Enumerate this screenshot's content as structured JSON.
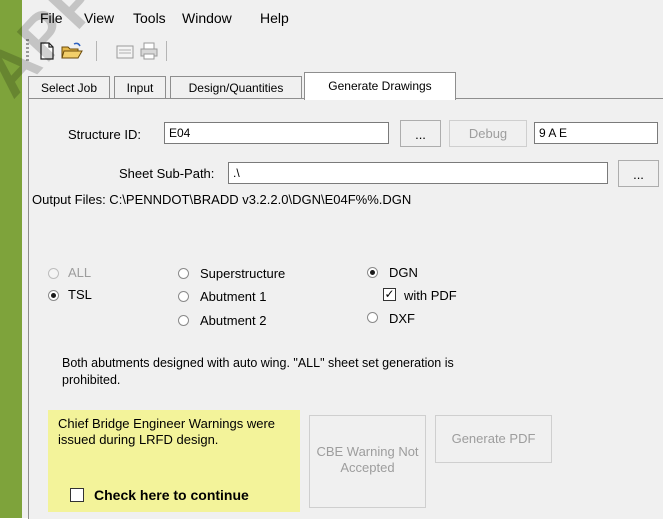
{
  "menu": [
    "File",
    "View",
    "Tools",
    "Window",
    "Help"
  ],
  "tabs": [
    "Select Job",
    "Input",
    "Design/Quantities",
    "Generate Drawings"
  ],
  "structure": {
    "label": "Structure ID:",
    "value": "E04",
    "browse_label": "...",
    "debug_label": "Debug",
    "code_value": "9 A E"
  },
  "sheet": {
    "label": "Sheet Sub-Path:",
    "value": ".\\",
    "browse_label": "..."
  },
  "output_files": "Output Files: C:\\PENNDOT\\BRADD v3.2.2.0\\DGN\\E04F%%.DGN",
  "sheets": {
    "all": "ALL",
    "tsl": "TSL",
    "superstructure": "Superstructure",
    "abutment1": "Abutment 1",
    "abutment2": "Abutment 2"
  },
  "formats": {
    "dgn": "DGN",
    "with_pdf": "with PDF",
    "dxf": "DXF"
  },
  "message": "Both abutments designed with auto wing. \"ALL\" sheet set generation is prohibited.",
  "warning": {
    "text": "Chief Bridge Engineer Warnings were issued during LRFD design.",
    "check_label": "Check here to continue"
  },
  "buttons": {
    "cbe": "CBE Warning Not Accepted",
    "generate_pdf": "Generate PDF"
  },
  "watermark": "APPLICABLE",
  "colors": {
    "warning_bg": "#f3f39a",
    "side_strip": "#7ea33b",
    "window_bg": "#f0f0f0"
  }
}
